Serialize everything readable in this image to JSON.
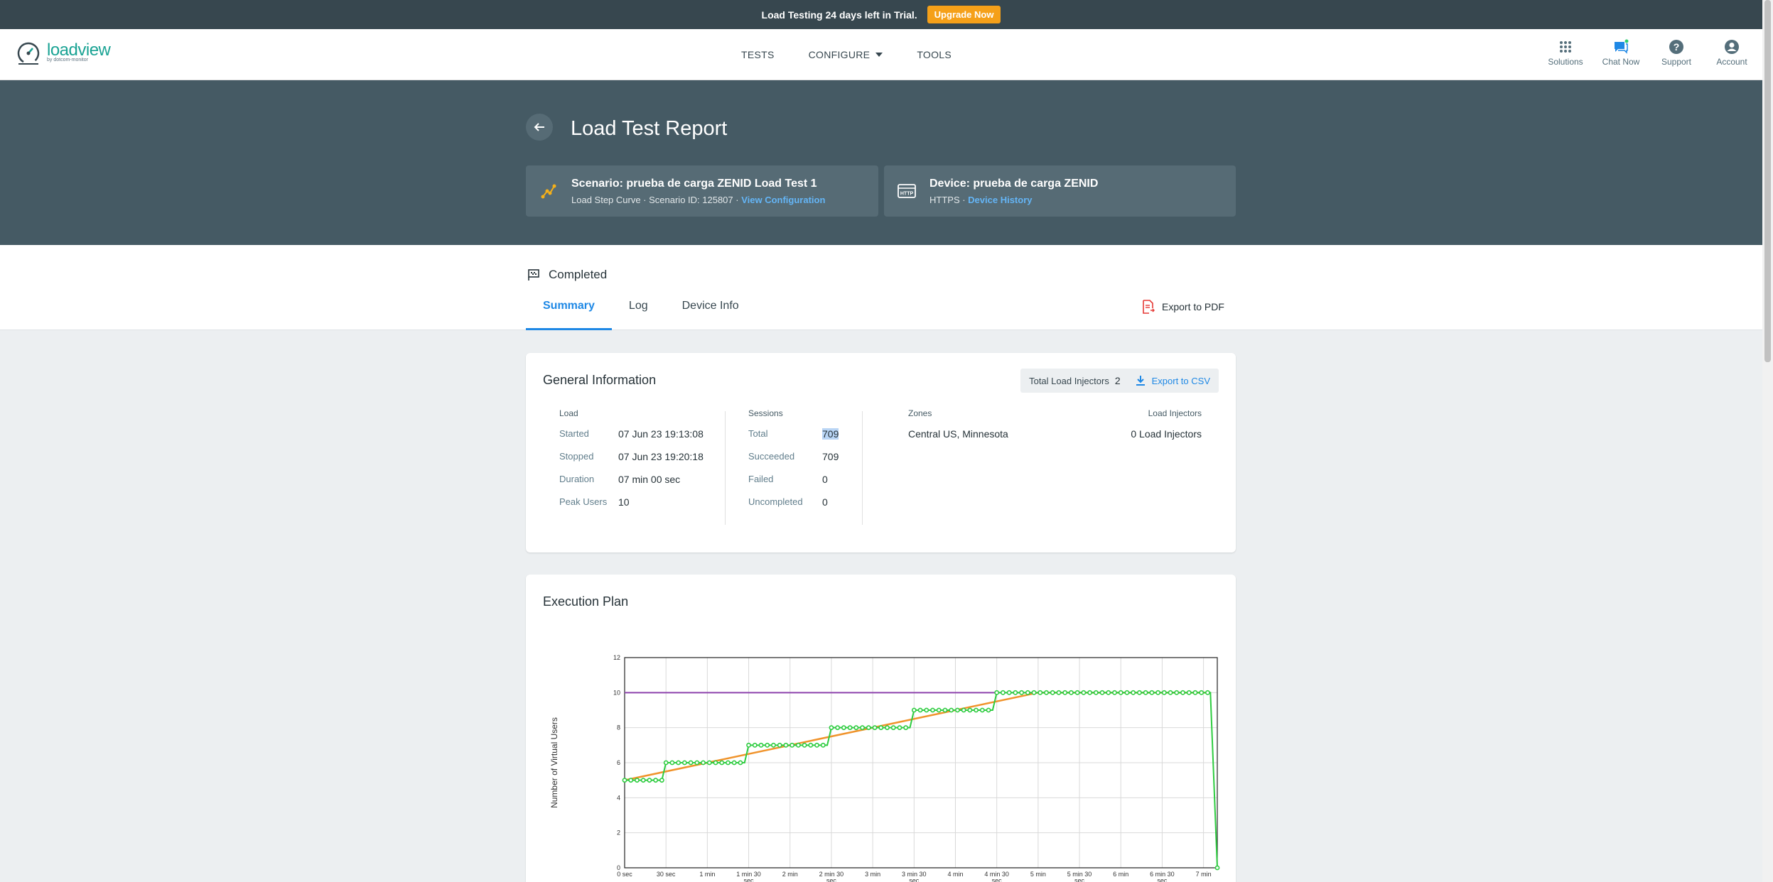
{
  "trial_banner": {
    "text": "Load Testing 24 days left in Trial.",
    "upgrade_label": "Upgrade Now"
  },
  "logo": {
    "name": "loadview",
    "tagline": "by dotcom-monitor"
  },
  "nav": {
    "tests": "TESTS",
    "configure": "CONFIGURE",
    "tools": "TOOLS"
  },
  "nav_tools": [
    {
      "label": "Solutions",
      "icon": "grid-icon"
    },
    {
      "label": "Chat Now",
      "icon": "chat-icon"
    },
    {
      "label": "Support",
      "icon": "help-icon"
    },
    {
      "label": "Account",
      "icon": "account-icon"
    }
  ],
  "page": {
    "title": "Load Test Report"
  },
  "scenario": {
    "title": "Scenario: prueba de carga ZENID Load Test 1",
    "sub": "Load Step Curve · Scenario ID: 125807 · ",
    "link": "View Configuration"
  },
  "device": {
    "title": "Device: prueba de carga ZENID",
    "sub": "HTTPS · ",
    "link": "Device History"
  },
  "status": {
    "text": "Completed"
  },
  "tabs": [
    "Summary",
    "Log",
    "Device Info"
  ],
  "export_pdf": "Export to PDF",
  "general_info": {
    "title": "General Information",
    "total_load_injectors_label": "Total Load Injectors",
    "total_load_injectors": "2",
    "export_csv": "Export to CSV",
    "load": {
      "heading": "Load",
      "rows": [
        {
          "label": "Started",
          "value": "07 Jun 23 19:13:08"
        },
        {
          "label": "Stopped",
          "value": "07 Jun 23 19:20:18"
        },
        {
          "label": "Duration",
          "value": "07 min 00 sec"
        },
        {
          "label": "Peak Users",
          "value": "10"
        }
      ]
    },
    "sessions": {
      "heading": "Sessions",
      "rows": [
        {
          "label": "Total",
          "value": "709"
        },
        {
          "label": "Succeeded",
          "value": "709"
        },
        {
          "label": "Failed",
          "value": "0"
        },
        {
          "label": "Uncompleted",
          "value": "0"
        }
      ]
    },
    "zones": {
      "heading": "Zones",
      "value": "Central US, Minnesota"
    },
    "load_injectors": {
      "heading": "Load Injectors",
      "value": "0 Load Injectors"
    }
  },
  "execution_plan": {
    "title": "Execution Plan"
  },
  "chart_data": {
    "type": "line",
    "title": "",
    "ylabel": "Number of Virtual Users",
    "ylim": [
      0,
      12
    ],
    "xlim": [
      0,
      430
    ],
    "yticks": [
      0,
      2,
      4,
      6,
      8,
      10,
      12
    ],
    "xticks": [
      {
        "x": 0,
        "label": [
          "0 sec"
        ]
      },
      {
        "x": 30,
        "label": [
          "30 sec"
        ]
      },
      {
        "x": 60,
        "label": [
          "1 min"
        ]
      },
      {
        "x": 90,
        "label": [
          "1 min 30",
          "sec"
        ]
      },
      {
        "x": 120,
        "label": [
          "2 min"
        ]
      },
      {
        "x": 150,
        "label": [
          "2 min 30",
          "sec"
        ]
      },
      {
        "x": 180,
        "label": [
          "3 min"
        ]
      },
      {
        "x": 210,
        "label": [
          "3 min 30",
          "sec"
        ]
      },
      {
        "x": 240,
        "label": [
          "4 min"
        ]
      },
      {
        "x": 270,
        "label": [
          "4 min 30",
          "sec"
        ]
      },
      {
        "x": 300,
        "label": [
          "5 min"
        ]
      },
      {
        "x": 330,
        "label": [
          "5 min 30",
          "sec"
        ]
      },
      {
        "x": 360,
        "label": [
          "6 min"
        ]
      },
      {
        "x": 390,
        "label": [
          "6 min 30",
          "sec"
        ]
      },
      {
        "x": 420,
        "label": [
          "7 min"
        ]
      }
    ],
    "grid": true,
    "series": [
      {
        "color": "#8e44ad",
        "x": [
          0,
          270,
          300,
          425
        ],
        "y": [
          10,
          10,
          10,
          10
        ]
      },
      {
        "color": "#f0932b",
        "x": [
          0,
          300,
          425
        ],
        "y": [
          5,
          10,
          10
        ]
      },
      {
        "color": "#2ecc40",
        "markers": true,
        "steps": [
          {
            "x0": 0,
            "x1": 27,
            "y": 5
          },
          {
            "x0": 30,
            "x1": 87,
            "y": 6
          },
          {
            "x0": 90,
            "x1": 147,
            "y": 7
          },
          {
            "x0": 150,
            "x1": 207,
            "y": 8
          },
          {
            "x0": 210,
            "x1": 267,
            "y": 9
          },
          {
            "x0": 270,
            "x1": 425,
            "y": 10
          }
        ],
        "end": {
          "x": 430,
          "y": 0
        }
      }
    ]
  },
  "colors": {
    "header": "#455a64",
    "accent": "#1e88e5",
    "brand": "#1aa394",
    "upgrade": "#f5a019"
  }
}
